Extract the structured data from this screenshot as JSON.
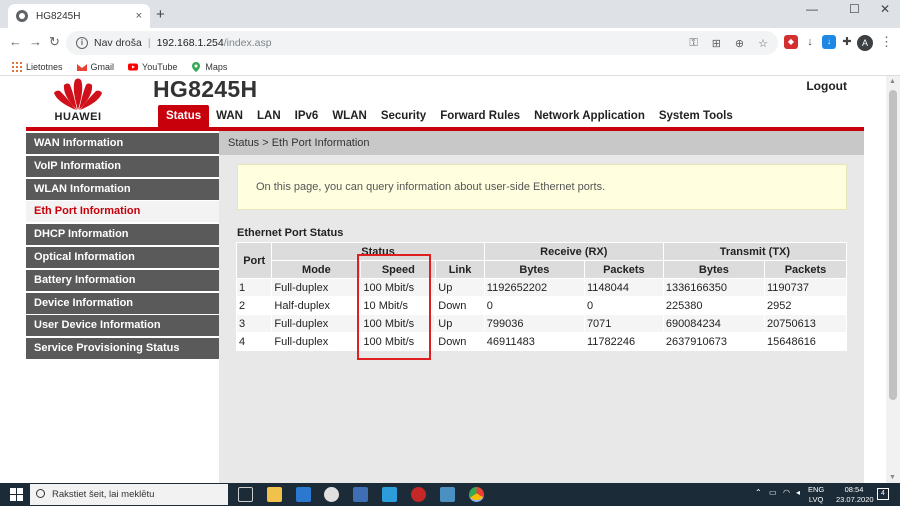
{
  "browser": {
    "tab_title": "HG8245H",
    "tab_close": "×",
    "new_tab": "+",
    "window_controls": [
      "—",
      "☐",
      "✕"
    ],
    "nav": {
      "back": "←",
      "forward": "→",
      "reload": "↻"
    },
    "address": {
      "security_text": "Nav droša",
      "host": "192.168.1.254",
      "path": "/index.asp"
    },
    "avatar_letter": "A",
    "bookmarks": [
      {
        "label": "Lietotnes",
        "icon": "apps-grid-icon"
      },
      {
        "label": "Gmail",
        "icon": "gmail-icon"
      },
      {
        "label": "YouTube",
        "icon": "youtube-icon"
      },
      {
        "label": "Maps",
        "icon": "maps-icon"
      }
    ]
  },
  "router": {
    "brand": "HUAWEI",
    "model": "HG8245H",
    "logout": "Logout",
    "nav": [
      "Status",
      "WAN",
      "LAN",
      "IPv6",
      "WLAN",
      "Security",
      "Forward Rules",
      "Network Application",
      "System Tools"
    ],
    "active_nav": "Status",
    "sidebar": [
      "WAN Information",
      "VoIP Information",
      "WLAN Information",
      "Eth Port Information",
      "DHCP Information",
      "Optical Information",
      "Battery Information",
      "Device Information",
      "User Device Information",
      "Service Provisioning Status"
    ],
    "active_sidebar": "Eth Port Information",
    "breadcrumb": "Status > Eth Port Information",
    "notice": "On this page, you can query information about user-side Ethernet ports.",
    "section_title": "Ethernet Port Status",
    "table": {
      "group_headers": {
        "port": "Port",
        "status": "Status",
        "receive": "Receive (RX)",
        "transmit": "Transmit (TX)"
      },
      "sub_headers": {
        "mode": "Mode",
        "speed": "Speed",
        "link": "Link",
        "rx_bytes": "Bytes",
        "rx_packets": "Packets",
        "tx_bytes": "Bytes",
        "tx_packets": "Packets"
      },
      "rows": [
        {
          "port": "1",
          "mode": "Full-duplex",
          "speed": "100 Mbit/s",
          "link": "Up",
          "rx_bytes": "1192652202",
          "rx_packets": "1148044",
          "tx_bytes": "1336166350",
          "tx_packets": "1190737"
        },
        {
          "port": "2",
          "mode": "Half-duplex",
          "speed": "10 Mbit/s",
          "link": "Down",
          "rx_bytes": "0",
          "rx_packets": "0",
          "tx_bytes": "225380",
          "tx_packets": "2952"
        },
        {
          "port": "3",
          "mode": "Full-duplex",
          "speed": "100 Mbit/s",
          "link": "Up",
          "rx_bytes": "799036",
          "rx_packets": "7071",
          "tx_bytes": "690084234",
          "tx_packets": "20750613"
        },
        {
          "port": "4",
          "mode": "Full-duplex",
          "speed": "100 Mbit/s",
          "link": "Down",
          "rx_bytes": "46911483",
          "rx_packets": "11782246",
          "tx_bytes": "2637910673",
          "tx_packets": "15648616"
        }
      ]
    }
  },
  "taskbar": {
    "search_placeholder": "Rakstiet šeit, lai meklētu",
    "lang": "ENG",
    "lang2": "LVQ",
    "time": "08:54",
    "date": "23.07.2020",
    "notifications": "4"
  },
  "colors": {
    "accent": "#c7000b",
    "sidebar": "#5a5a5a",
    "highlight": "#e02020"
  }
}
